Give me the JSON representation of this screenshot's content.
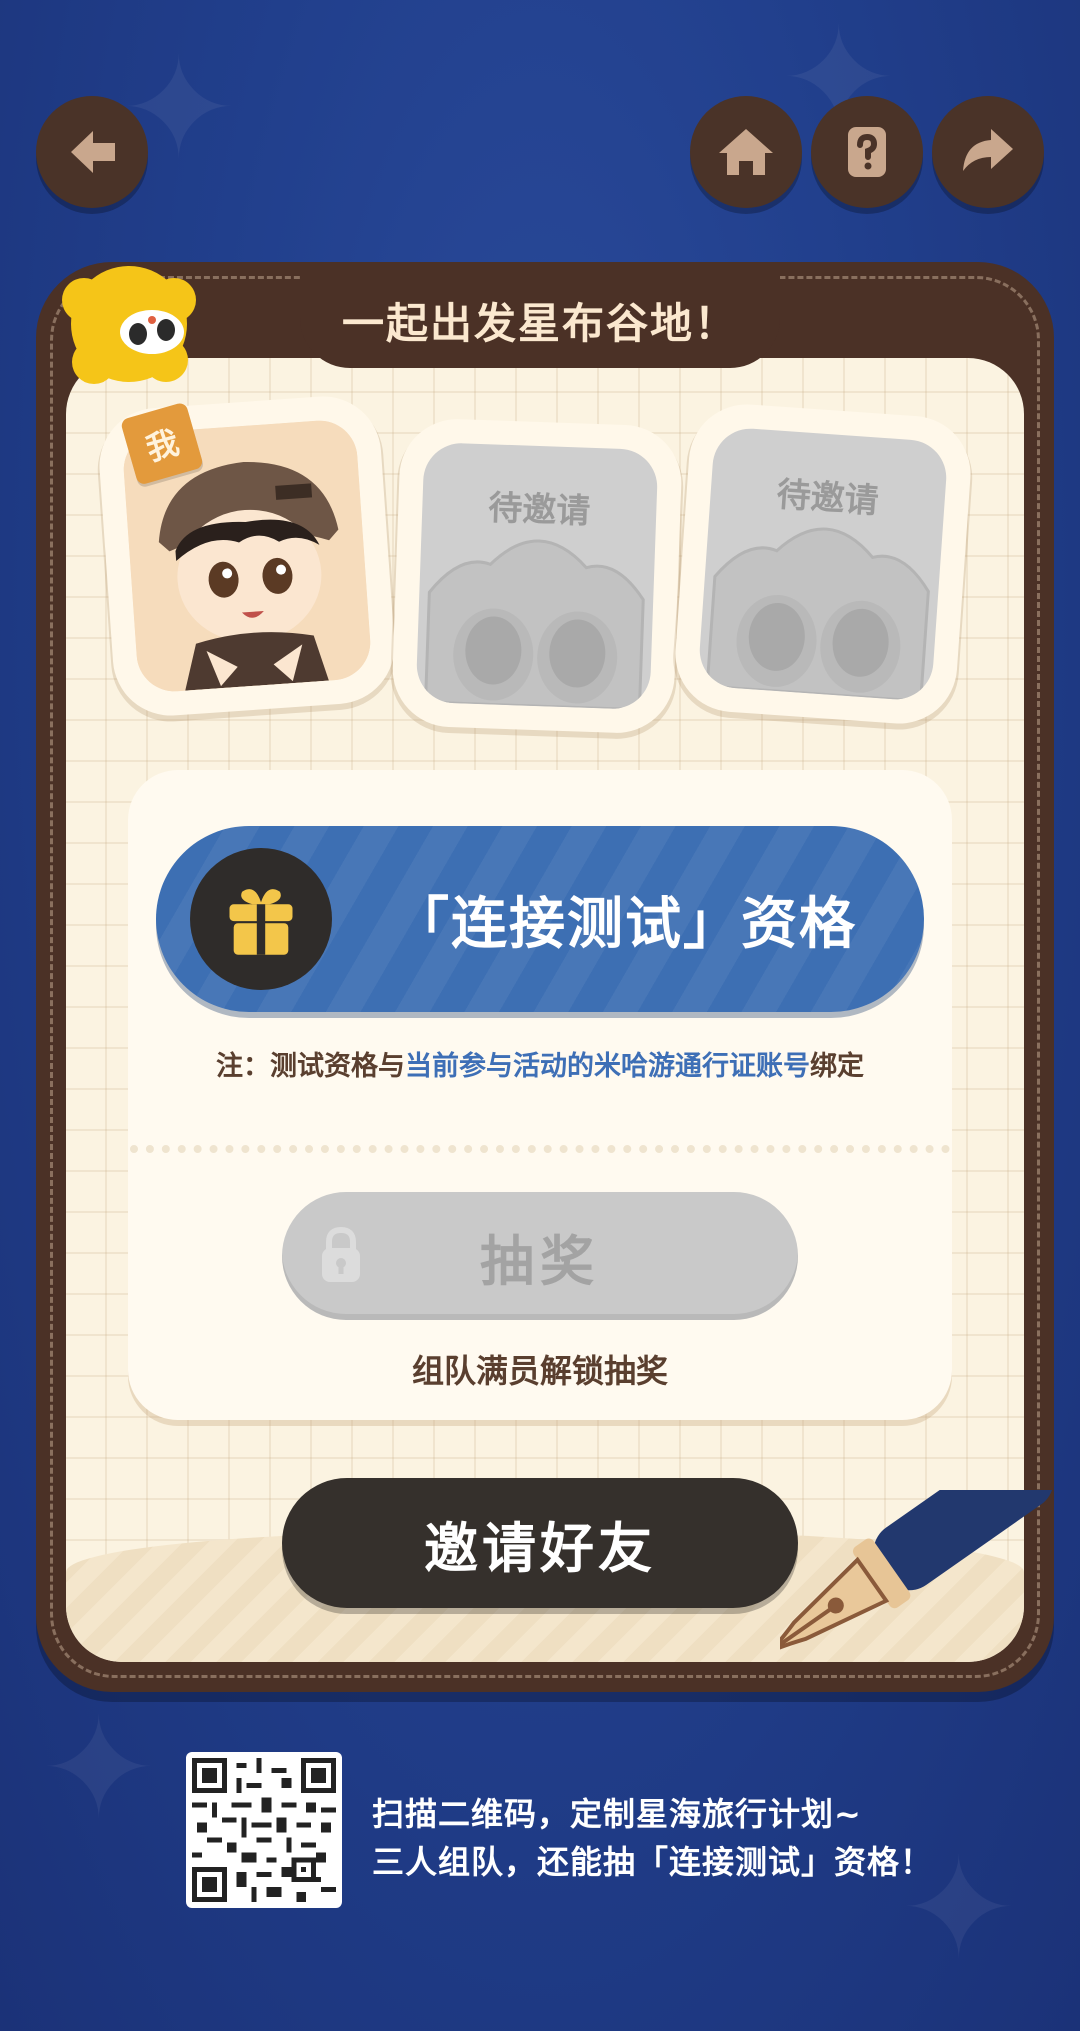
{
  "title": "一起出发星布谷地！",
  "slots": [
    {
      "badge": "我",
      "label": ""
    },
    {
      "label": "待邀请"
    },
    {
      "label": "待邀请"
    }
  ],
  "reward": {
    "label": "「连接测试」资格",
    "note_prefix": "注：测试资格与",
    "note_highlight": "当前参与活动的米哈游通行证账号",
    "note_suffix": "绑定"
  },
  "lottery": {
    "label": "抽奖",
    "hint": "组队满员解锁抽奖",
    "locked": true
  },
  "invite_label": "邀请好友",
  "footer": {
    "line1": "扫描二维码，定制星海旅行计划~",
    "line2": "三人组队，还能抽「连接测试」资格！"
  },
  "icons": {
    "back": "back-arrow-icon",
    "home": "home-icon",
    "help": "question-icon",
    "share": "share-arrow-icon",
    "gift": "gift-icon",
    "lock": "lock-icon"
  },
  "colors": {
    "background": "#213f8c",
    "card_frame": "#4b3126",
    "reward_bar": "#3d6fb3",
    "highlight_text": "#3e6fb6",
    "invite_button": "#35302c",
    "disabled_button": "#c9c9c9"
  }
}
